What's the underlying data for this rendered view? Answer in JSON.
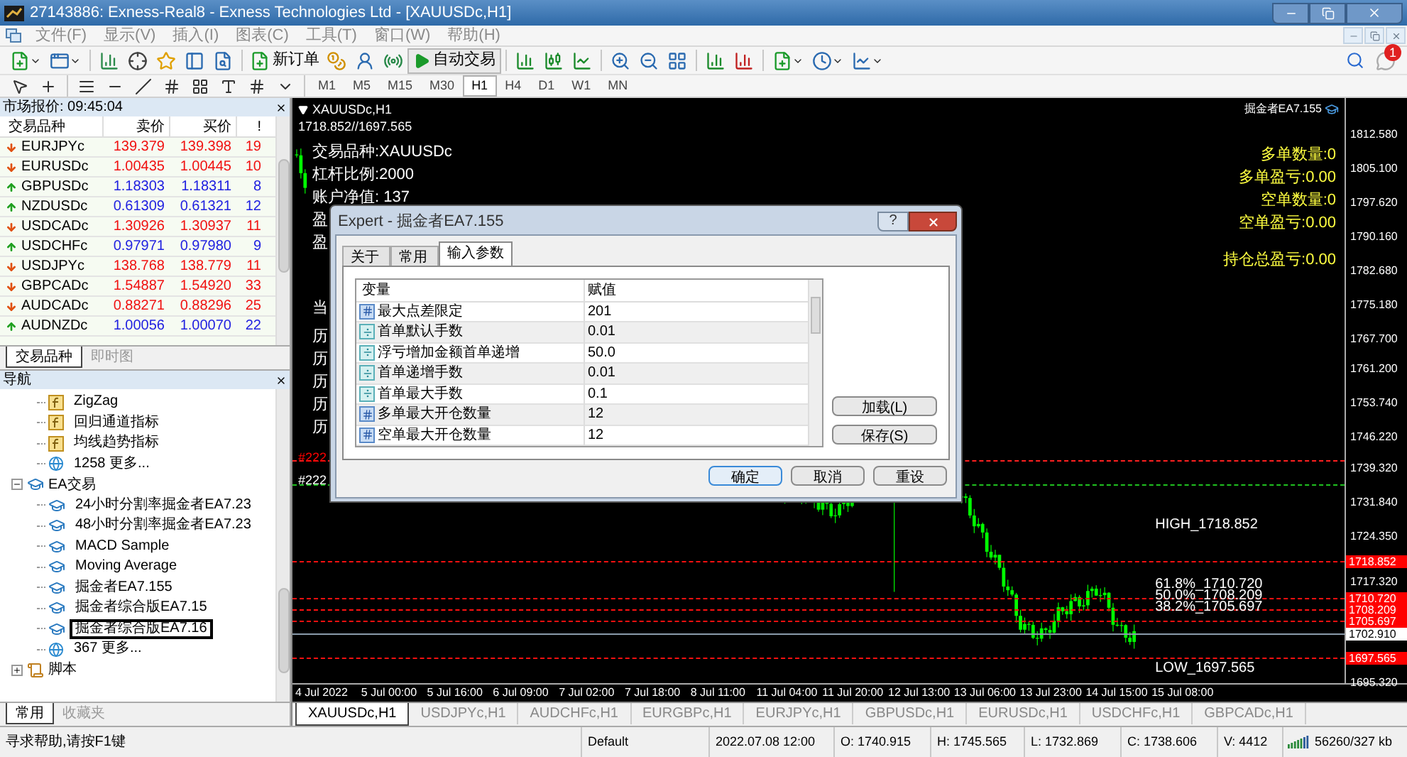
{
  "window": {
    "title": "27143886: Exness-Real8 - Exness Technologies Ltd - [XAUUSDc,H1]"
  },
  "menu": [
    "文件(F)",
    "显示(V)",
    "插入(I)",
    "图表(C)",
    "工具(T)",
    "窗口(W)",
    "帮助(H)"
  ],
  "toolbar": {
    "new_order": "新订单",
    "auto_trading": "自动交易",
    "notification_count": "1"
  },
  "timeframes": [
    {
      "label": "M1",
      "selected": false
    },
    {
      "label": "M5",
      "selected": false
    },
    {
      "label": "M15",
      "selected": false
    },
    {
      "label": "M30",
      "selected": false
    },
    {
      "label": "H1",
      "selected": true
    },
    {
      "label": "H4",
      "selected": false
    },
    {
      "label": "D1",
      "selected": false
    },
    {
      "label": "W1",
      "selected": false
    },
    {
      "label": "MN",
      "selected": false
    }
  ],
  "market_watch": {
    "title": "市场报价: 09:45:04",
    "columns": [
      "交易品种",
      "卖价",
      "买价",
      "!"
    ],
    "rows": [
      {
        "symbol": "EURJPYc",
        "bid": "139.379",
        "ask": "139.398",
        "spread": "19",
        "up": false
      },
      {
        "symbol": "EURUSDc",
        "bid": "1.00435",
        "ask": "1.00445",
        "spread": "10",
        "up": false
      },
      {
        "symbol": "GBPUSDc",
        "bid": "1.18303",
        "ask": "1.18311",
        "spread": "8",
        "up": true
      },
      {
        "symbol": "NZDUSDc",
        "bid": "0.61309",
        "ask": "0.61321",
        "spread": "12",
        "up": true
      },
      {
        "symbol": "USDCADc",
        "bid": "1.30926",
        "ask": "1.30937",
        "spread": "11",
        "up": false
      },
      {
        "symbol": "USDCHFc",
        "bid": "0.97971",
        "ask": "0.97980",
        "spread": "9",
        "up": true
      },
      {
        "symbol": "USDJPYc",
        "bid": "138.768",
        "ask": "138.779",
        "spread": "11",
        "up": false
      },
      {
        "symbol": "GBPCADc",
        "bid": "1.54887",
        "ask": "1.54920",
        "spread": "33",
        "up": false
      },
      {
        "symbol": "AUDCADc",
        "bid": "0.88271",
        "ask": "0.88296",
        "spread": "25",
        "up": false
      },
      {
        "symbol": "AUDNZDc",
        "bid": "1.00056",
        "ask": "1.00070",
        "spread": "22",
        "up": true
      }
    ],
    "tabs": [
      {
        "label": "交易品种",
        "selected": true
      },
      {
        "label": "即时图",
        "selected": false
      }
    ]
  },
  "navigator": {
    "title": "导航",
    "items_continued": [
      {
        "label": "ZigZag",
        "kind": "indicator"
      },
      {
        "label": "回归通道指标",
        "kind": "indicator"
      },
      {
        "label": "均线趋势指标",
        "kind": "indicator"
      },
      {
        "label": "1258 更多...",
        "kind": "more"
      }
    ],
    "tree": [
      {
        "label": "EA交易",
        "kind": "experts",
        "expanded": true,
        "children": [
          {
            "label": "24小时分割率掘金者EA7.23",
            "kind": "expert",
            "selected": false
          },
          {
            "label": "48小时分割率掘金者EA7.23",
            "kind": "expert",
            "selected": false
          },
          {
            "label": "MACD Sample",
            "kind": "expert",
            "selected": false
          },
          {
            "label": "Moving Average",
            "kind": "expert",
            "selected": false
          },
          {
            "label": "掘金者EA7.155",
            "kind": "expert",
            "selected": false
          },
          {
            "label": "掘金者综合版EA7.15",
            "kind": "expert",
            "selected": false
          },
          {
            "label": "掘金者综合版EA7.16",
            "kind": "expert",
            "selected": true
          },
          {
            "label": "367 更多...",
            "kind": "more",
            "selected": false
          }
        ]
      },
      {
        "label": "脚本",
        "kind": "scripts",
        "expanded": false
      }
    ],
    "tabs": [
      {
        "label": "常用",
        "selected": true
      },
      {
        "label": "收藏夹",
        "selected": false
      }
    ]
  },
  "chart": {
    "title": "XAUUSDc,H1",
    "range": "1718.852//1697.565",
    "expert_name": "掘金者EA7.155",
    "info_left": [
      "交易品种:XAUUSDc",
      "杠杆比例:2000",
      "账户净值: 137",
      "盈",
      "盈"
    ],
    "info_left_lower": [
      "当",
      "历",
      "历",
      "历",
      "历",
      "历"
    ],
    "info_right": [
      "多单数量:0",
      "多单盈亏:0.00",
      "空单数量:0",
      "空单盈亏:0.00"
    ],
    "info_right_total": "持仓总盈亏:0.00",
    "marker_lines": [
      {
        "label": "#222",
        "color": "#ff0000"
      },
      {
        "label": "#222",
        "color": "#ffffff"
      }
    ],
    "price_ticks": [
      "1812.580",
      "1805.100",
      "1797.620",
      "1790.160",
      "1782.680",
      "1775.180",
      "1767.700",
      "1761.200",
      "1753.740",
      "1746.220",
      "1739.320",
      "1731.840",
      "1724.350",
      "1717.320",
      "1695.320"
    ],
    "current_price": "1702.910",
    "levels": [
      {
        "label": "HIGH_1718.852",
        "tag": "1718.852"
      },
      {
        "label": "61.8%_1710.720",
        "tag": "1710.720"
      },
      {
        "label": "50.0%_1708.209",
        "tag": "1708.209"
      },
      {
        "label": "38.2%_1705.697",
        "tag": "1705.697"
      },
      {
        "label": "LOW_1697.565",
        "tag": "1697.565"
      }
    ],
    "time_ticks": [
      "4 Jul 2022",
      "5 Jul 00:00",
      "5 Jul 16:00",
      "6 Jul 09:00",
      "7 Jul 02:00",
      "7 Jul 18:00",
      "8 Jul 11:00",
      "11 Jul 04:00",
      "11 Jul 20:00",
      "12 Jul 13:00",
      "13 Jul 06:00",
      "13 Jul 23:00",
      "14 Jul 15:00",
      "15 Jul 08:00"
    ],
    "tabs": [
      {
        "label": "XAUUSDc,H1",
        "selected": true
      },
      {
        "label": "USDJPYc,H1",
        "selected": false
      },
      {
        "label": "AUDCHFc,H1",
        "selected": false
      },
      {
        "label": "EURGBPc,H1",
        "selected": false
      },
      {
        "label": "EURJPYc,H1",
        "selected": false
      },
      {
        "label": "GBPUSDc,H1",
        "selected": false
      },
      {
        "label": "EURUSDc,H1",
        "selected": false
      },
      {
        "label": "USDCHFc,H1",
        "selected": false
      },
      {
        "label": "GBPCADc,H1",
        "selected": false
      }
    ]
  },
  "dialog": {
    "title": "Expert - 掘金者EA7.155",
    "help_button": "?",
    "tabs": [
      {
        "label": "关于",
        "selected": false
      },
      {
        "label": "常用",
        "selected": false
      },
      {
        "label": "输入参数",
        "selected": true
      }
    ],
    "columns": [
      "变量",
      "赋值"
    ],
    "params": [
      {
        "name": "最大点差限定",
        "value": "201",
        "kind": "int"
      },
      {
        "name": "首单默认手数",
        "value": "0.01",
        "kind": "double"
      },
      {
        "name": "浮亏增加金额首单递增",
        "value": "50.0",
        "kind": "double"
      },
      {
        "name": "首单递增手数",
        "value": "0.01",
        "kind": "double"
      },
      {
        "name": "首单最大手数",
        "value": "0.1",
        "kind": "double"
      },
      {
        "name": "多单最大开仓数量",
        "value": "12",
        "kind": "int"
      },
      {
        "name": "空单最大开仓数量",
        "value": "12",
        "kind": "int"
      }
    ],
    "side_buttons": [
      "加载(L)",
      "保存(S)"
    ],
    "buttons": [
      {
        "label": "确定",
        "default": true
      },
      {
        "label": "取消",
        "default": false
      },
      {
        "label": "重设",
        "default": false
      }
    ]
  },
  "status_bar": {
    "help": "寻求帮助,请按F1键",
    "profile": "Default",
    "time": "2022.07.08 12:00",
    "open": "O: 1740.915",
    "high": "H: 1745.565",
    "low": "L: 1732.869",
    "close": "C: 1738.606",
    "volume": "V: 4412",
    "traffic": "56260/327 kb"
  }
}
